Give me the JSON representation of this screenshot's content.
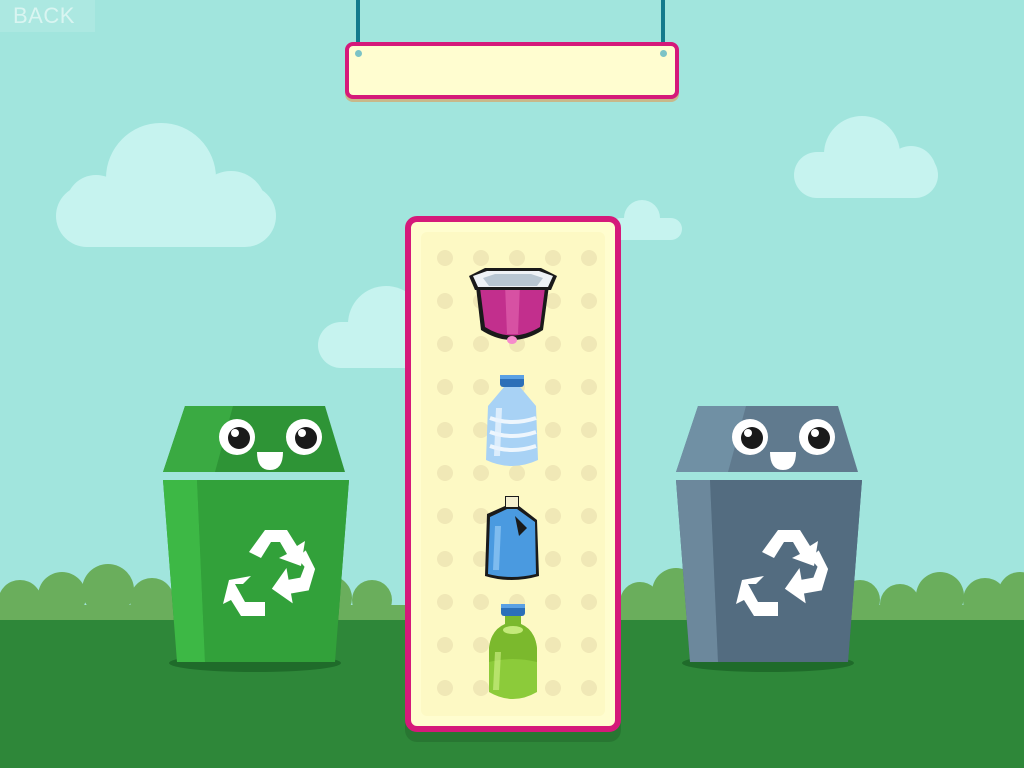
{
  "back_button": {
    "label": "BACK"
  },
  "sign": {
    "text": ""
  },
  "bins": [
    {
      "name": "green-bin",
      "color": "#31a139",
      "lid": "#2e9436",
      "icon": "recycle-icon"
    },
    {
      "name": "gray-bin",
      "color": "#536c80",
      "lid": "#607a8e",
      "icon": "recycle-icon"
    }
  ],
  "items": [
    {
      "name": "yogurt-cup",
      "icon": "yogurt-cup-icon",
      "color": "#c22f8d"
    },
    {
      "name": "water-jug",
      "icon": "water-jug-icon",
      "color": "#a8d2f5"
    },
    {
      "name": "detergent-bottle",
      "icon": "detergent-bottle-icon",
      "color": "#4a9ae0"
    },
    {
      "name": "soda-bottle",
      "icon": "soda-bottle-icon",
      "color": "#8ccb3a"
    }
  ],
  "colors": {
    "sky": "#a1e5dd",
    "ground": "#2e8739",
    "tray_border": "#d5197a",
    "tray_fill": "#fffdcf"
  }
}
